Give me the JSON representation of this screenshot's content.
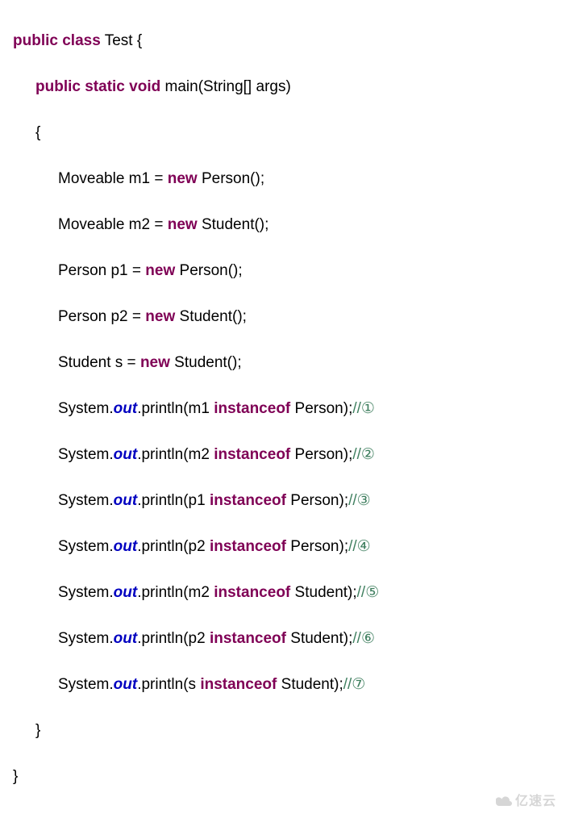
{
  "kw": {
    "public": "public",
    "class": "class",
    "static": "static",
    "void": "void",
    "new": "new",
    "instanceof": "instanceof"
  },
  "cls": {
    "Test": "Test",
    "Moveable": "Moveable",
    "Person": "Person",
    "Student": "Student",
    "String": "String",
    "System": "System"
  },
  "field": {
    "out": "out"
  },
  "method": {
    "main": "main",
    "println": "println"
  },
  "vars": {
    "args": "args",
    "m1": "m1",
    "m2": "m2",
    "p1": "p1",
    "p2": "p2",
    "s": "s"
  },
  "punct": {
    "openBrace": "{",
    "closeBrace": "}",
    "openParen": "(",
    "closeParen": ")",
    "semicolon": ";",
    "dot": ".",
    "brackets": "[]",
    "eq": " = ",
    "sp": " "
  },
  "comments": {
    "c1": "//①",
    "c2": "//②",
    "c3": "//③",
    "c4": "//④",
    "c5": "//⑤",
    "c6": "//⑥",
    "c7": "//⑦"
  },
  "watermark": "亿速云"
}
